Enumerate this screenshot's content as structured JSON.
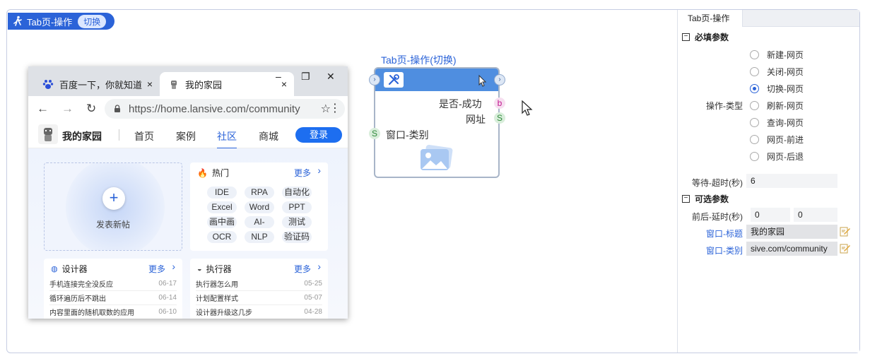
{
  "header": {
    "title": "Tab页-操作",
    "mode_badge": "切换"
  },
  "browser": {
    "tabs": [
      {
        "label": "百度一下，你就知道",
        "close": "×"
      },
      {
        "label": "我的家园",
        "close": "×"
      }
    ],
    "window_controls": {
      "minimize": "–",
      "restore": "❐",
      "close": "✕"
    },
    "nav": {
      "back": "←",
      "forward": "→",
      "reload": "↻"
    },
    "url": "https://home.lansive.com/community",
    "site": {
      "name": "我的家园",
      "nav": [
        "首页",
        "案例",
        "社区",
        "商城"
      ],
      "active_nav": "社区",
      "login": "登录"
    },
    "new_post": {
      "plus": "+",
      "label": "发表新帖"
    },
    "hot": {
      "title": "热门",
      "more": "更多",
      "tags": [
        "IDE",
        "RPA",
        "自动化",
        "Excel",
        "Word",
        "PPT",
        "画中画",
        "AI-",
        "测试",
        "OCR",
        "NLP",
        "验证码"
      ]
    },
    "designer": {
      "title": "设计器",
      "more": "更多",
      "rows": [
        {
          "text": "手机连接完全没反应",
          "date": "06-17"
        },
        {
          "text": "循环遍历后不跳出",
          "date": "06-14"
        },
        {
          "text": "内容里面的随机取数的应用",
          "date": "06-10"
        }
      ]
    },
    "executor": {
      "title": "执行器",
      "more": "更多",
      "rows": [
        {
          "text": "执行器怎么用",
          "date": "05-25"
        },
        {
          "text": "计划配置样式",
          "date": "05-07"
        },
        {
          "text": "设计器升级这几步",
          "date": "04-28"
        }
      ]
    }
  },
  "node": {
    "title": "Tab页-操作(切换)",
    "outputs": [
      {
        "label": "是否-成功",
        "badge": "b"
      },
      {
        "label": "网址",
        "badge": "S"
      }
    ],
    "input": {
      "label": "窗口-类别",
      "badge": "S"
    },
    "port_glyph": "›"
  },
  "panel": {
    "tab": "Tab页-操作",
    "required_section": "必填参数",
    "optional_section": "可选参数",
    "collapse_glyph": "−",
    "op_type_label": "操作-类型",
    "op_types": [
      "新建-网页",
      "关闭-网页",
      "切换-网页",
      "刷新-网页",
      "查询-网页",
      "网页-前进",
      "网页-后退"
    ],
    "op_selected": "切换-网页",
    "timeout_label": "等待-超时(秒)",
    "timeout_value": "6",
    "delay_label": "前后-延时(秒)",
    "delay_before": "0",
    "delay_after": "0",
    "window_title_label": "窗口-标题",
    "window_title_value": "我的家园",
    "window_class_label": "窗口-类别",
    "window_class_value": "sive.com/community"
  },
  "colors": {
    "accent": "#2b63d8",
    "node_header": "#4f8ee0",
    "login": "#1d6ef0"
  }
}
